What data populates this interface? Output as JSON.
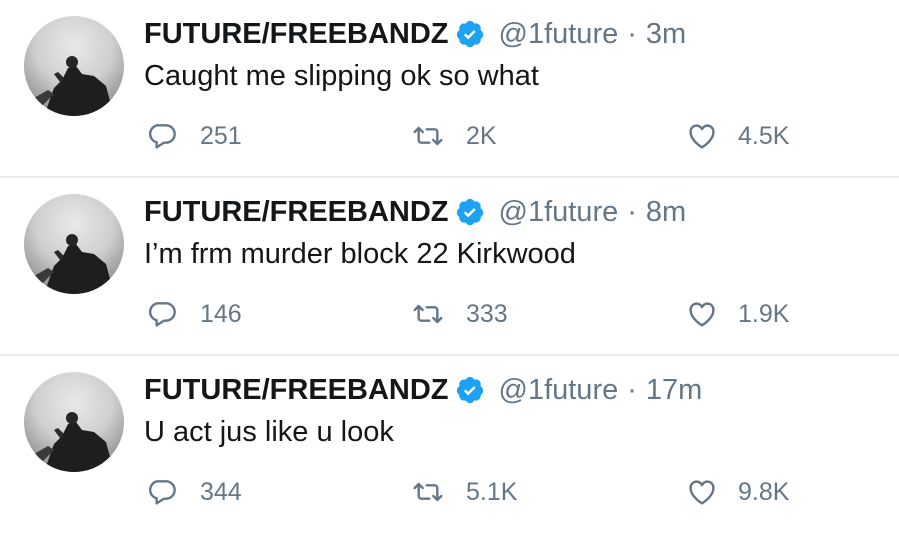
{
  "tweets": [
    {
      "display_name": "FUTURE/FREEBANDZ",
      "handle": "@1future",
      "separator": "·",
      "time": "3m",
      "text": "Caught me slipping ok so what",
      "replies": "251",
      "retweets": "2K",
      "likes": "4.5K"
    },
    {
      "display_name": "FUTURE/FREEBANDZ",
      "handle": "@1future",
      "separator": "·",
      "time": "8m",
      "text": "I’m frm murder block 22 Kirkwood",
      "replies": "146",
      "retweets": "333",
      "likes": "1.9K"
    },
    {
      "display_name": "FUTURE/FREEBANDZ",
      "handle": "@1future",
      "separator": "·",
      "time": "17m",
      "text": "U act jus like u look",
      "replies": "344",
      "retweets": "5.1K",
      "likes": "9.8K"
    }
  ],
  "icons": {
    "verified": "verified-badge-icon",
    "reply": "reply-bubble-icon",
    "retweet": "retweet-arrows-icon",
    "like": "heart-icon"
  },
  "colors": {
    "verified": "#1da1f2",
    "muted_text": "#657786",
    "primary_text": "#14171a",
    "divider": "#e6ecf0"
  }
}
